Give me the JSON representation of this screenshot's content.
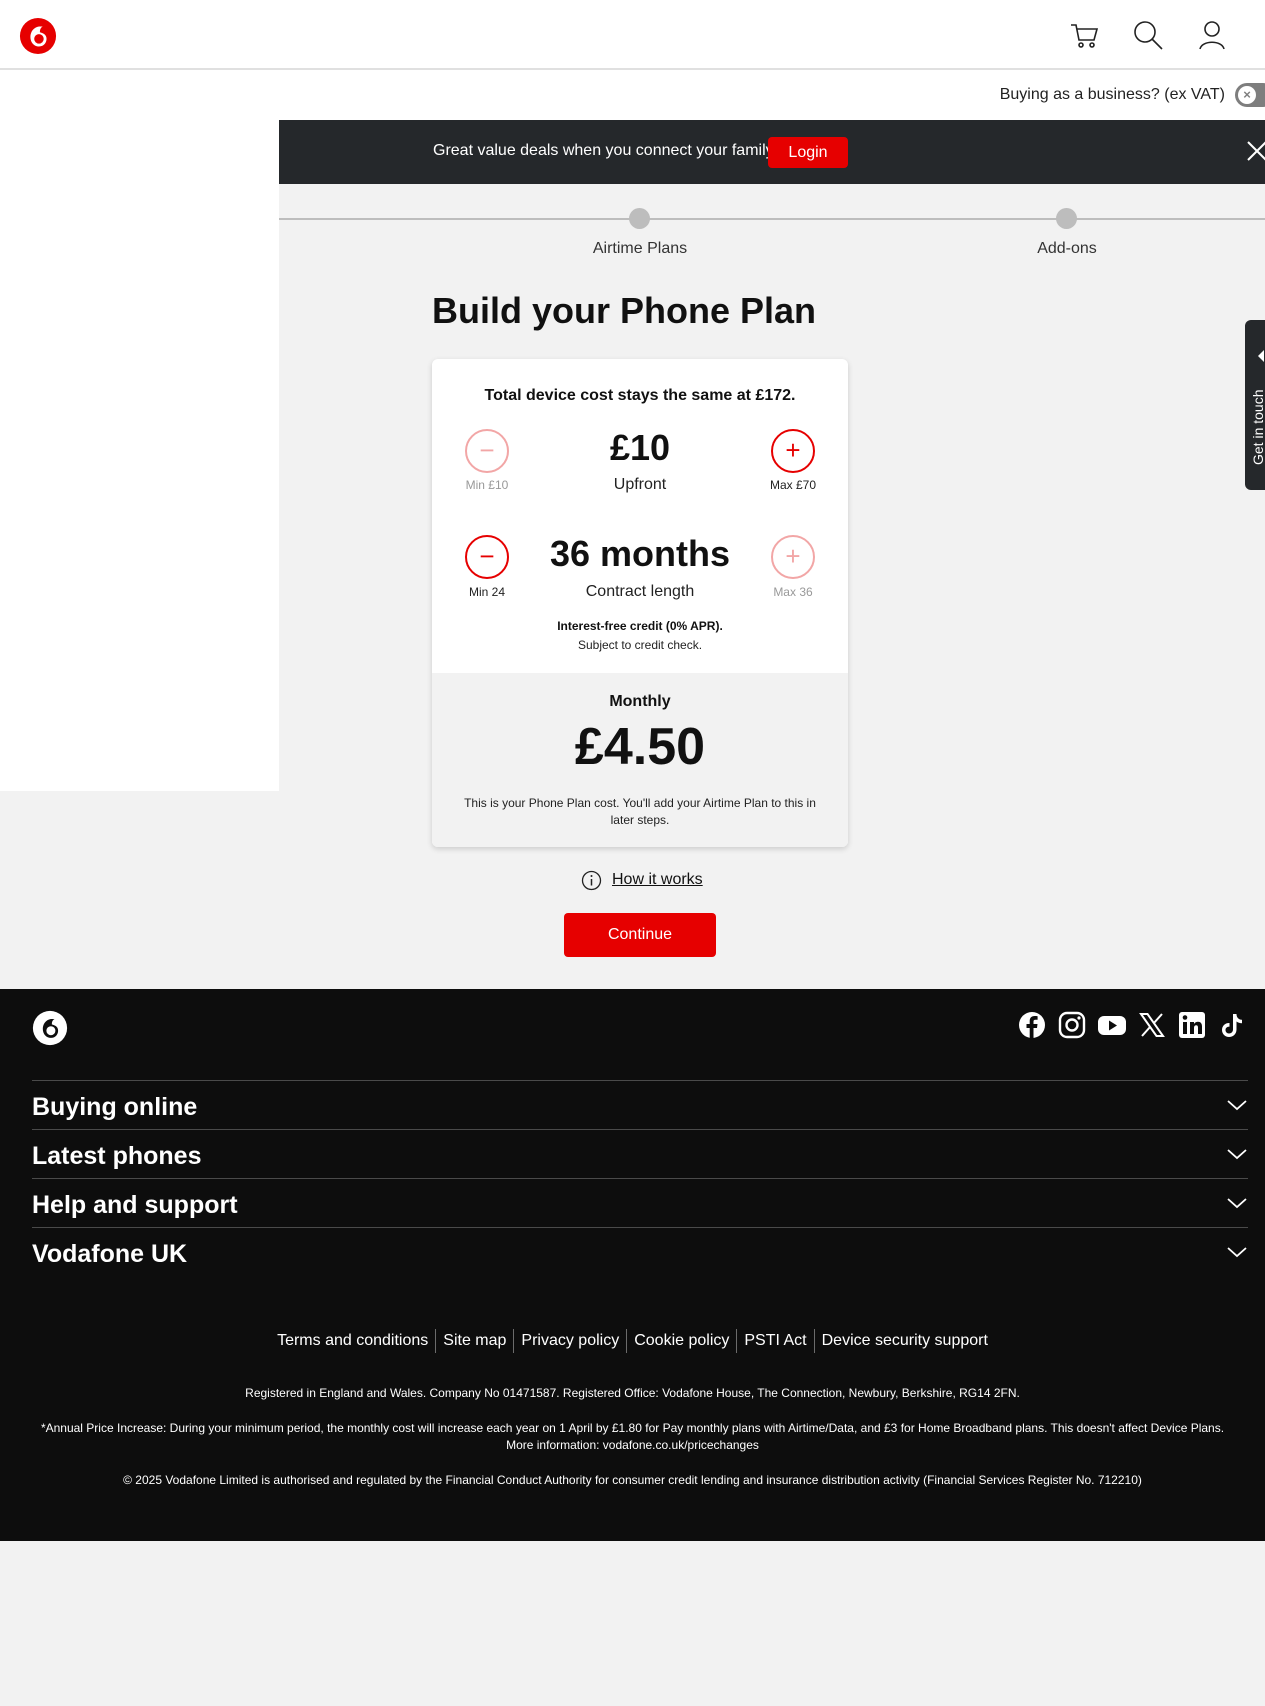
{
  "header": {
    "logo": "vodafone-logo",
    "icons": [
      "cart-icon",
      "search-icon",
      "user-icon"
    ]
  },
  "business": {
    "label": "Buying as a business? (ex VAT)"
  },
  "promo": {
    "text": "Great value deals when you connect your family",
    "login_label": "Login"
  },
  "stepper": {
    "steps": [
      {
        "label": "Airtime Plans"
      },
      {
        "label": "Add-ons"
      }
    ]
  },
  "page": {
    "title": "Build your Phone Plan"
  },
  "plan": {
    "summary": "Total device cost stays the same at £172.",
    "upfront": {
      "value": "£10",
      "label": "Upfront",
      "min": "Min £10",
      "max": "Max £70"
    },
    "contract": {
      "value": "36 months",
      "label": "Contract length",
      "min": "Min 24",
      "max": "Max 36"
    },
    "credit_bold": "Interest-free credit (0% APR).",
    "credit_note": "Subject to credit check.",
    "monthly_label": "Monthly",
    "monthly_value": "£4.50",
    "monthly_note": "This is your Phone Plan cost. You'll add your Airtime Plan to this in later steps."
  },
  "how_it_works": "How it works",
  "continue_label": "Continue",
  "get_in_touch": "Get in touch",
  "footer": {
    "accordions": [
      "Buying online",
      "Latest phones",
      "Help and support",
      "Vodafone UK"
    ],
    "links": [
      "Terms and conditions",
      "Site map",
      "Privacy policy",
      "Cookie policy",
      "PSTI Act",
      "Device security support"
    ],
    "registered": "Registered in England and Wales. Company No 01471587. Registered Office: Vodafone House, The Connection, Newbury, Berkshire, RG14 2FN.",
    "annual_increase": "*Annual Price Increase: During your minimum period, the monthly cost will increase each year on 1 April by £1.80 for Pay monthly plans with Airtime/Data, and £3 for Home Broadband plans. This doesn't affect Device Plans. More information: vodafone.co.uk/pricechanges",
    "copyright": "© 2025 Vodafone Limited is authorised and regulated by the Financial Conduct Authority for consumer credit lending and insurance distribution activity (Financial Services Register No. 712210)"
  },
  "colors": {
    "brand_red": "#e60000",
    "banner_dark": "#25282b",
    "footer_bg": "#0d0d0d"
  }
}
